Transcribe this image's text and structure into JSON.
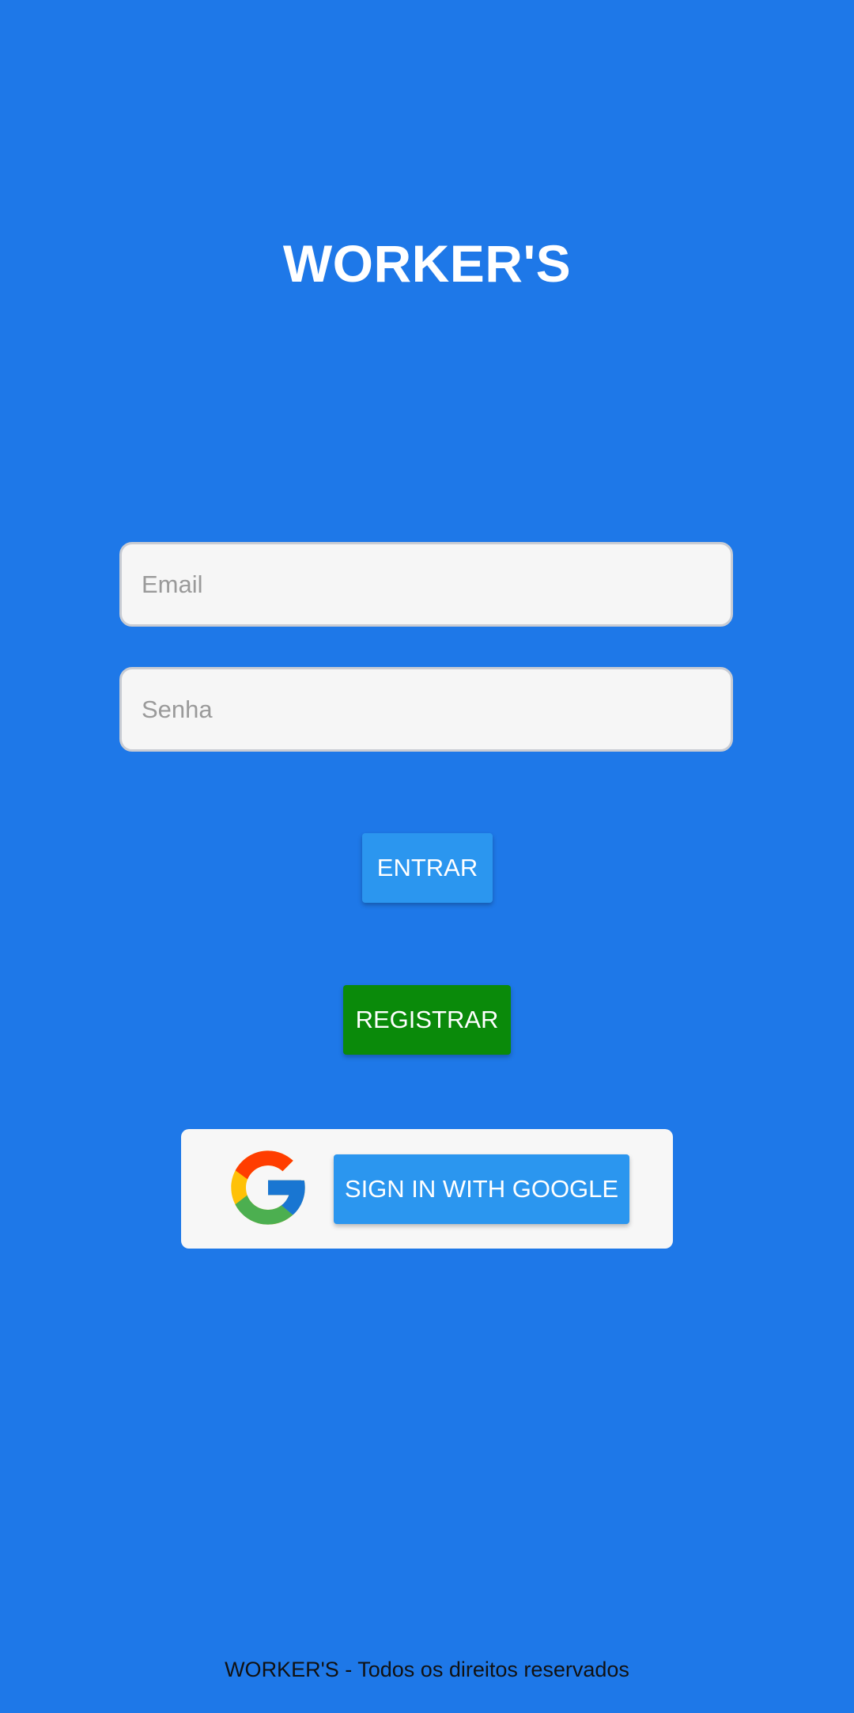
{
  "header": {
    "title": "WORKER'S"
  },
  "form": {
    "email_placeholder": "Email",
    "password_placeholder": "Senha"
  },
  "actions": {
    "enter_label": "ENTRAR",
    "register_label": "REGISTRAR",
    "google_label": "SIGN IN WITH GOOGLE"
  },
  "footer": {
    "text": "WORKER'S - Todos os direitos reservados"
  },
  "colors": {
    "background": "#1e78e8",
    "primary_button": "#2b96ef",
    "register_button": "#0a8a0a",
    "card": "#f7f7f7"
  },
  "icons": {
    "google": "google-g-logo-icon"
  }
}
